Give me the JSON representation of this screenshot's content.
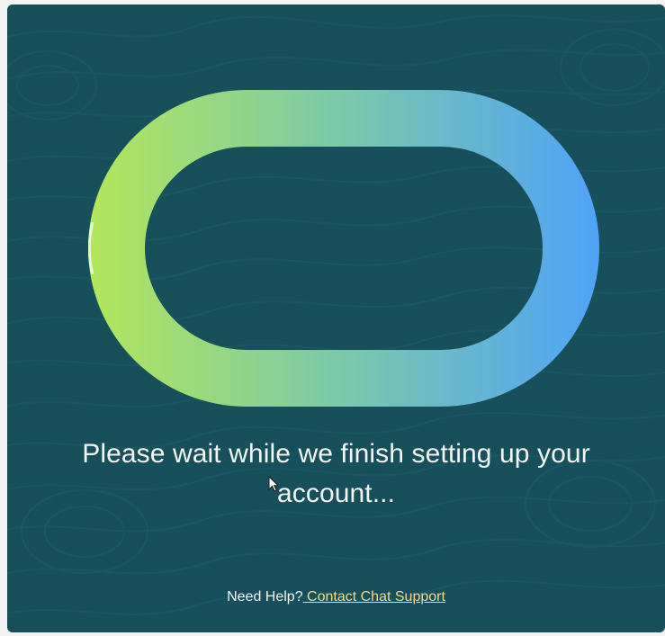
{
  "loading": {
    "message": "Please wait while we finish setting up your account...",
    "logo_name": "oracle-ring-logo",
    "gradient_colors": [
      "#b4e55a",
      "#7ccaa8",
      "#4fa3f7"
    ]
  },
  "help": {
    "prefix": "Need Help?",
    "link_text": " Contact Chat Support",
    "link_color": "#f4d58d"
  },
  "theme": {
    "panel_color": "#17505a",
    "text_color": "#f2f6f7"
  }
}
